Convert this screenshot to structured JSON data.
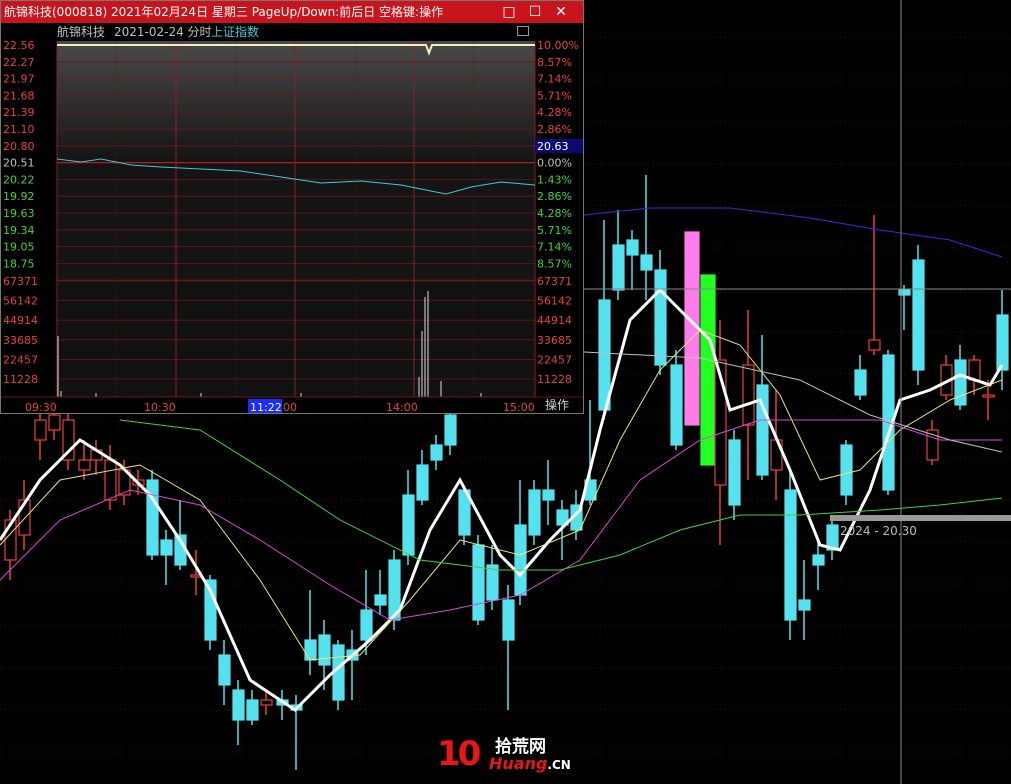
{
  "window": {
    "title": "航锦科技(000818) 2021年02月24日 星期三 PageUp/Down:前后日 空格键:操作",
    "minimize_glyph": "□",
    "maximize_glyph": "☐",
    "close_glyph": "✕"
  },
  "subheader": {
    "stock": "航锦科技",
    "date_mode": "2021-02-24 分时",
    "index": "上证指数"
  },
  "price_axis": [
    "22.56",
    "22.27",
    "21.97",
    "21.68",
    "21.39",
    "21.10",
    "20.80",
    "20.51",
    "20.22",
    "19.92",
    "19.63",
    "19.34",
    "19.05",
    "18.75"
  ],
  "pct_axis": [
    "10.00%",
    "8.57%",
    "7.14%",
    "5.71%",
    "4.28%",
    "2.86%",
    "",
    "0.00%",
    "1.43%",
    "2.86%",
    "4.28%",
    "5.71%",
    "7.14%",
    "8.57%"
  ],
  "current_price_box": "20.63",
  "volume_axis": [
    "67371",
    "56142",
    "44914",
    "33685",
    "22457",
    "11228"
  ],
  "time_axis": {
    "t0930": "09:30",
    "t1030": "10:30",
    "cursor": "11:22",
    "t1300": "00",
    "t1400": "14:00",
    "t1500": "15:00"
  },
  "operate_button": "操作",
  "main_chart_range_label": "2024 - 20.30",
  "watermark": {
    "number": "10",
    "chinese": "拾荒网",
    "english": "Huang",
    "suffix": ".CN"
  },
  "colors": {
    "up": "#e8413c",
    "down": "#55e2ee",
    "ma5": "#ffffff",
    "ma10": "#e6e67a",
    "ma20": "#d94bd8",
    "ma60": "#3fd43f",
    "ma120": "#3030e0",
    "titlebar": "#c8141c",
    "index_line": "#43c7d6"
  }
}
